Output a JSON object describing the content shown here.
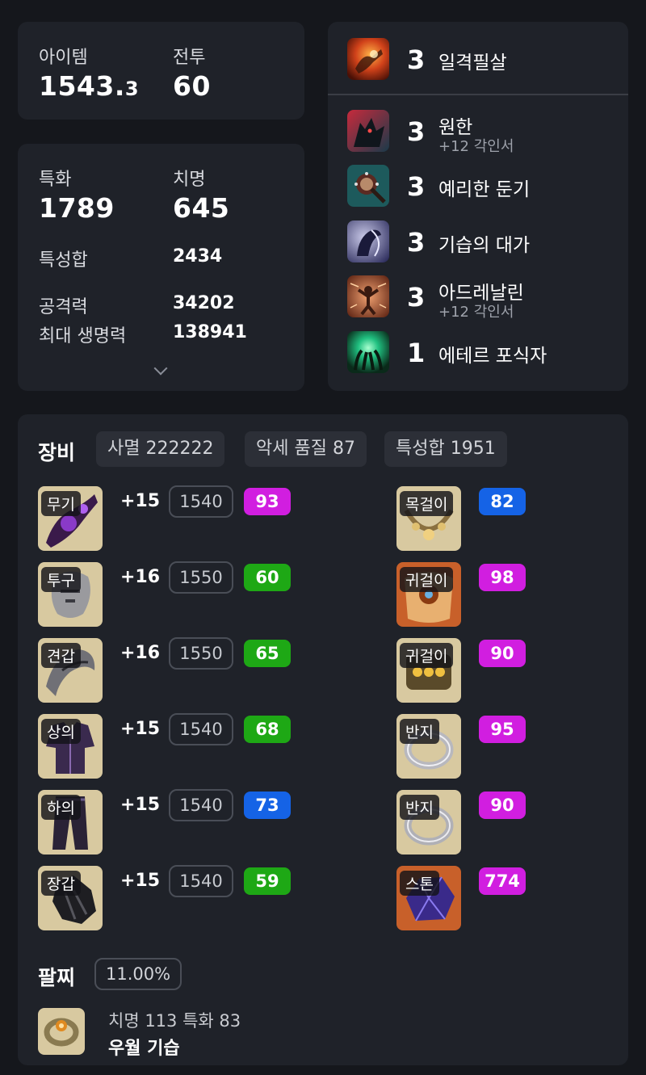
{
  "summary": {
    "item_label": "아이템",
    "item_value_main": "1543.",
    "item_value_frac": "3",
    "combat_label": "전투",
    "combat_value": "60"
  },
  "stats": {
    "spec_label": "특화",
    "spec_value": "1789",
    "crit_label": "치명",
    "crit_value": "645",
    "total_label": "특성합",
    "total_value": "2434",
    "attack_label": "공격력",
    "attack_value": "34202",
    "hp_label": "최대 생명력",
    "hp_value": "138941"
  },
  "engravings": [
    {
      "level": "3",
      "name": "일격필살",
      "sub": ""
    },
    {
      "level": "3",
      "name": "원한",
      "sub": "+12 각인서"
    },
    {
      "level": "3",
      "name": "예리한 둔기",
      "sub": ""
    },
    {
      "level": "3",
      "name": "기습의 대가",
      "sub": ""
    },
    {
      "level": "3",
      "name": "아드레날린",
      "sub": "+12 각인서"
    },
    {
      "level": "1",
      "name": "에테르 포식자",
      "sub": ""
    }
  ],
  "equipment": {
    "title": "장비",
    "chips": [
      "사멸 222222",
      "악세 품질 87",
      "특성합 1951"
    ],
    "armor": [
      {
        "tag": "무기",
        "plus": "+15",
        "level": "1540",
        "quality": "93",
        "qcolor": "purple"
      },
      {
        "tag": "투구",
        "plus": "+16",
        "level": "1550",
        "quality": "60",
        "qcolor": "green"
      },
      {
        "tag": "견갑",
        "plus": "+16",
        "level": "1550",
        "quality": "65",
        "qcolor": "green"
      },
      {
        "tag": "상의",
        "plus": "+15",
        "level": "1540",
        "quality": "68",
        "qcolor": "green"
      },
      {
        "tag": "하의",
        "plus": "+15",
        "level": "1540",
        "quality": "73",
        "qcolor": "blue"
      },
      {
        "tag": "장갑",
        "plus": "+15",
        "level": "1540",
        "quality": "59",
        "qcolor": "green"
      }
    ],
    "accessories": [
      {
        "tag": "목걸이",
        "quality": "82",
        "qcolor": "blue"
      },
      {
        "tag": "귀걸이",
        "quality": "98",
        "qcolor": "purple"
      },
      {
        "tag": "귀걸이",
        "quality": "90",
        "qcolor": "purple"
      },
      {
        "tag": "반지",
        "quality": "95",
        "qcolor": "purple"
      },
      {
        "tag": "반지",
        "quality": "90",
        "qcolor": "purple"
      },
      {
        "tag": "스톤",
        "quality": "774",
        "qcolor": "purple"
      }
    ]
  },
  "bracelet": {
    "title": "팔찌",
    "percent": "11.00%",
    "line1": "치명 113  특화 83",
    "line2": "우월  기습"
  }
}
